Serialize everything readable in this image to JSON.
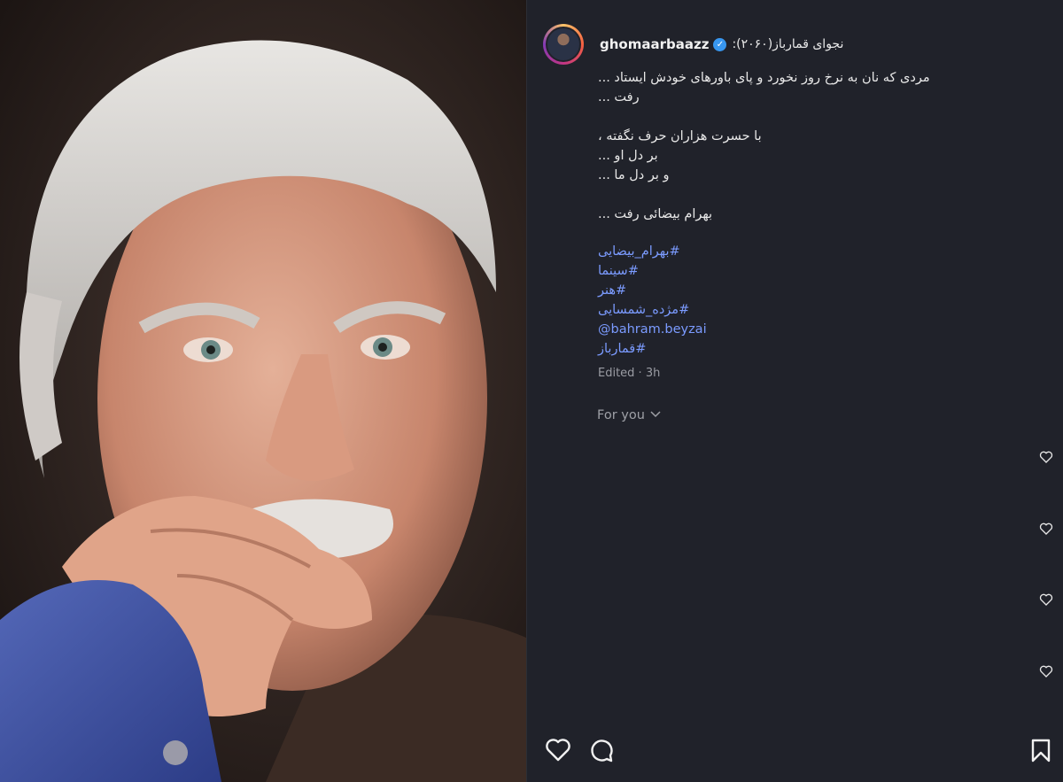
{
  "post": {
    "username": "ghomaarbaazz",
    "header_suffix": "نجوای قمارباز(۲۰۶۰):",
    "caption": {
      "line1": "مردی که نان به نرخ روز نخورد و پای باورهای خودش ایستاد ...",
      "line2": "رفت ...",
      "line3": "با حسرت هزاران حرف نگفته ،",
      "line4": "بر دل او ...",
      "line5": "و بر دل ما ...",
      "line6": "بهرام بیضائی رفت ..."
    },
    "tags": [
      "#بهرام_بیضایی",
      "#سینما",
      "#هنر",
      "#مژده_شمسایی",
      "@bahram.beyzai",
      "#قمارباز"
    ],
    "meta": "Edited · 3h",
    "for_you_label": "For you"
  },
  "icons": {
    "verified": "verified-badge-icon",
    "like": "heart-icon",
    "comment": "comment-icon",
    "save": "bookmark-icon",
    "chevron": "chevron-down-icon"
  },
  "colors": {
    "panel_bg": "#20222a",
    "link": "#7b9bff",
    "verified": "#3897f0"
  }
}
